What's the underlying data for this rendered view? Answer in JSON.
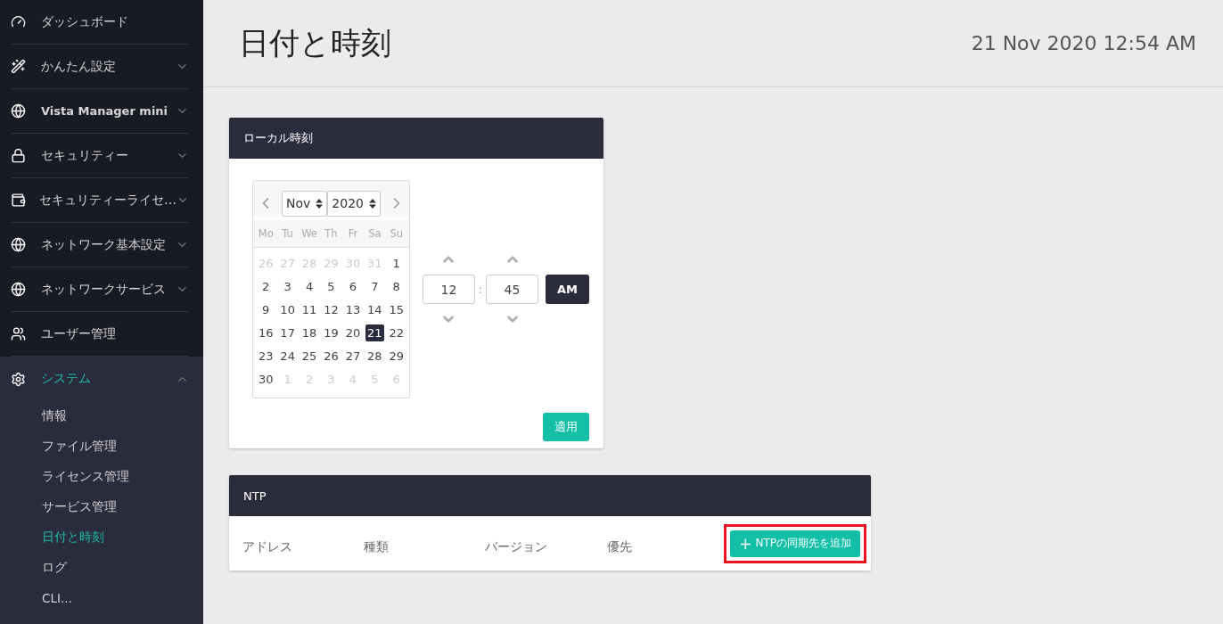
{
  "sidebar": {
    "items": [
      {
        "label": "ダッシュボード",
        "expandable": false,
        "expanded": false,
        "selected": false
      },
      {
        "label": "かんたん設定",
        "expandable": true,
        "expanded": false,
        "selected": false
      },
      {
        "label": "Vista Manager mini",
        "expandable": true,
        "expanded": false,
        "selected": false
      },
      {
        "label": "セキュリティー",
        "expandable": true,
        "expanded": false,
        "selected": false
      },
      {
        "label": "セキュリティーライセ…",
        "expandable": true,
        "expanded": false,
        "selected": false
      },
      {
        "label": "ネットワーク基本設定",
        "expandable": true,
        "expanded": false,
        "selected": false
      },
      {
        "label": "ネットワークサービス",
        "expandable": true,
        "expanded": false,
        "selected": false
      },
      {
        "label": "ユーザー管理",
        "expandable": false,
        "expanded": false,
        "selected": false
      },
      {
        "label": "システム",
        "expandable": true,
        "expanded": true,
        "selected": true,
        "children": [
          {
            "label": "情報",
            "selected": false
          },
          {
            "label": "ファイル管理",
            "selected": false
          },
          {
            "label": "ライセンス管理",
            "selected": false
          },
          {
            "label": "サービス管理",
            "selected": false
          },
          {
            "label": "日付と時刻",
            "selected": true
          },
          {
            "label": "ログ",
            "selected": false
          },
          {
            "label": "CLI...",
            "selected": false
          }
        ]
      }
    ]
  },
  "page": {
    "title": "日付と時刻",
    "datetime": "21 Nov 2020 12:54 AM"
  },
  "local_time": {
    "title": "ローカル時刻",
    "calendar": {
      "month": "Nov",
      "year": "2020",
      "weekdays": [
        "Mo",
        "Tu",
        "We",
        "Th",
        "Fr",
        "Sa",
        "Su"
      ],
      "weeks": [
        [
          {
            "label": "26",
            "muted": true,
            "selected": false
          },
          {
            "label": "27",
            "muted": true,
            "selected": false
          },
          {
            "label": "28",
            "muted": true,
            "selected": false
          },
          {
            "label": "29",
            "muted": true,
            "selected": false
          },
          {
            "label": "30",
            "muted": true,
            "selected": false
          },
          {
            "label": "31",
            "muted": true,
            "selected": false
          },
          {
            "label": "1",
            "muted": false,
            "selected": false
          }
        ],
        [
          {
            "label": "2",
            "muted": false,
            "selected": false
          },
          {
            "label": "3",
            "muted": false,
            "selected": false
          },
          {
            "label": "4",
            "muted": false,
            "selected": false
          },
          {
            "label": "5",
            "muted": false,
            "selected": false
          },
          {
            "label": "6",
            "muted": false,
            "selected": false
          },
          {
            "label": "7",
            "muted": false,
            "selected": false
          },
          {
            "label": "8",
            "muted": false,
            "selected": false
          }
        ],
        [
          {
            "label": "9",
            "muted": false,
            "selected": false
          },
          {
            "label": "10",
            "muted": false,
            "selected": false
          },
          {
            "label": "11",
            "muted": false,
            "selected": false
          },
          {
            "label": "12",
            "muted": false,
            "selected": false
          },
          {
            "label": "13",
            "muted": false,
            "selected": false
          },
          {
            "label": "14",
            "muted": false,
            "selected": false
          },
          {
            "label": "15",
            "muted": false,
            "selected": false
          }
        ],
        [
          {
            "label": "16",
            "muted": false,
            "selected": false
          },
          {
            "label": "17",
            "muted": false,
            "selected": false
          },
          {
            "label": "18",
            "muted": false,
            "selected": false
          },
          {
            "label": "19",
            "muted": false,
            "selected": false
          },
          {
            "label": "20",
            "muted": false,
            "selected": false
          },
          {
            "label": "21",
            "muted": false,
            "selected": true
          },
          {
            "label": "22",
            "muted": false,
            "selected": false
          }
        ],
        [
          {
            "label": "23",
            "muted": false,
            "selected": false
          },
          {
            "label": "24",
            "muted": false,
            "selected": false
          },
          {
            "label": "25",
            "muted": false,
            "selected": false
          },
          {
            "label": "26",
            "muted": false,
            "selected": false
          },
          {
            "label": "27",
            "muted": false,
            "selected": false
          },
          {
            "label": "28",
            "muted": false,
            "selected": false
          },
          {
            "label": "29",
            "muted": false,
            "selected": false
          }
        ],
        [
          {
            "label": "30",
            "muted": false,
            "selected": false
          },
          {
            "label": "1",
            "muted": true,
            "selected": false
          },
          {
            "label": "2",
            "muted": true,
            "selected": false
          },
          {
            "label": "3",
            "muted": true,
            "selected": false
          },
          {
            "label": "4",
            "muted": true,
            "selected": false
          },
          {
            "label": "5",
            "muted": true,
            "selected": false
          },
          {
            "label": "6",
            "muted": true,
            "selected": false
          }
        ]
      ]
    },
    "time": {
      "hour": "12",
      "separator": ":",
      "minute": "45",
      "meridiem": "AM"
    },
    "apply_button": "適用"
  },
  "ntp": {
    "title": "NTP",
    "columns": [
      "アドレス",
      "種類",
      "バージョン",
      "優先"
    ],
    "add_button": {
      "icon": "+",
      "label": "NTPの同期先を追加",
      "highlighted": true
    }
  }
}
